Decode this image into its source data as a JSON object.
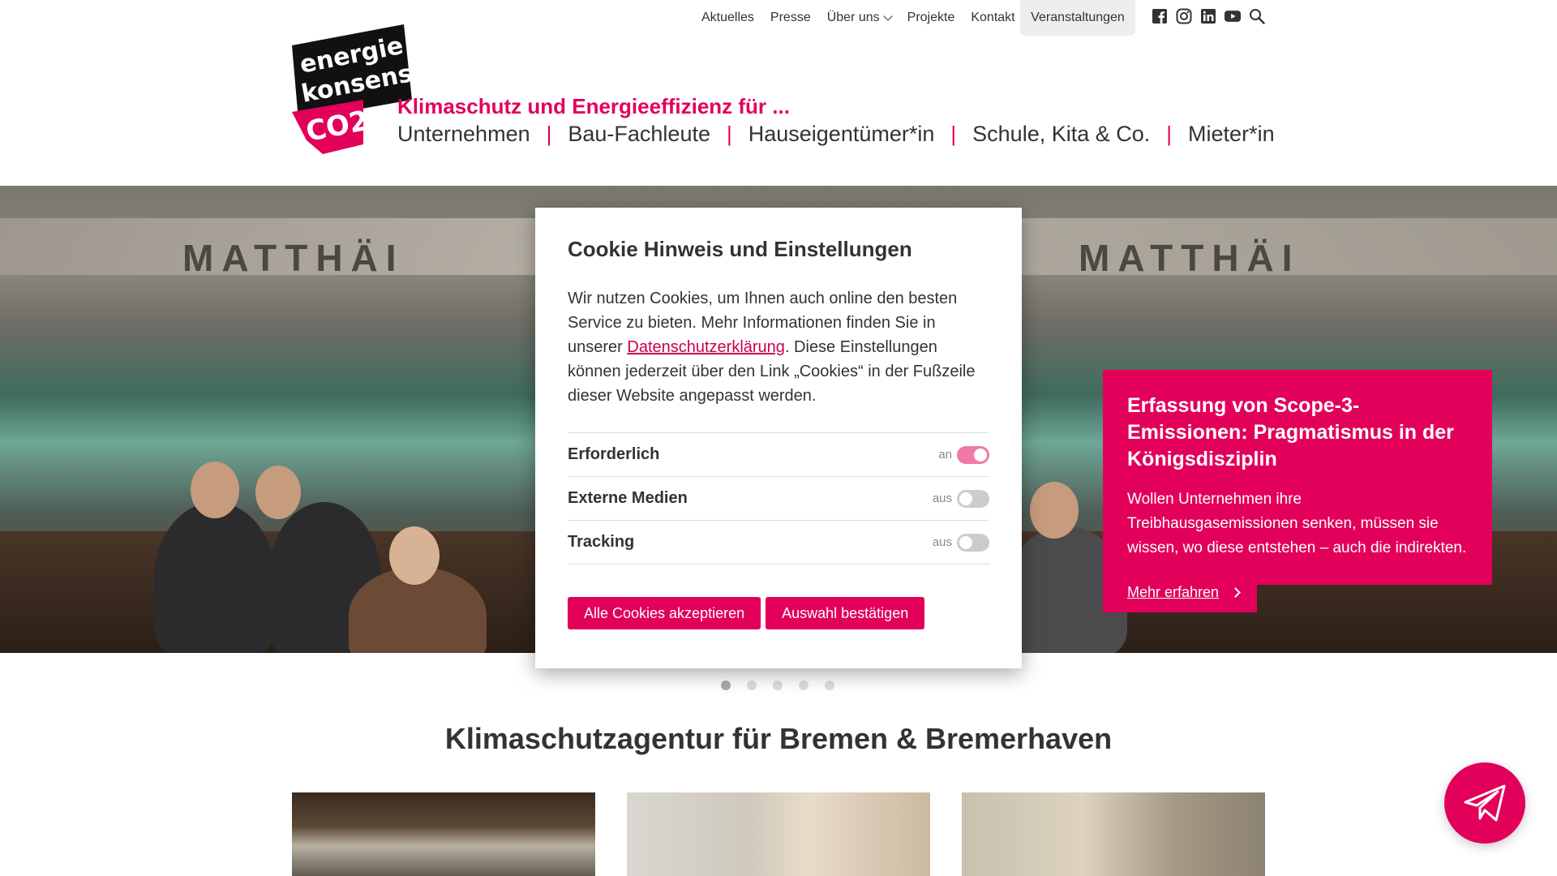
{
  "top_nav": {
    "links": [
      "Aktuelles",
      "Presse",
      "Über uns",
      "Projekte",
      "Kontakt"
    ],
    "events_label": "Veranstaltungen",
    "social_icons": [
      "facebook-icon",
      "instagram-icon",
      "linkedin-icon",
      "youtube-icon"
    ],
    "search_icon": "search-icon"
  },
  "logo": {
    "line1": "energie",
    "line2": "konsens",
    "mark": "CO2"
  },
  "header": {
    "tagline": "Klimaschutz und Energieeffizienz für ...",
    "targets": [
      "Unternehmen",
      "Bau-Fachleute",
      "Hauseigentümer*in",
      "Schule, Kita & Co.",
      "Mieter*in"
    ]
  },
  "hero": {
    "banner_text": "MATTHÄI",
    "promo_title": "Erfassung von Scope-3-Emissionen: Pragmatismus in der Königsdisziplin",
    "promo_text": "Wollen Unternehmen ihre Treibhausgasemissionen senken, müssen sie wissen, wo diese entstehen – auch die indirekten. …",
    "promo_link": "Mehr erfahren",
    "slide_count": 5,
    "active_slide": 1
  },
  "cookie_modal": {
    "title": "Cookie Hinweis und Einstellungen",
    "text_before_link": "Wir nutzen Cookies, um Ihnen auch online den besten Service zu bieten. Mehr Informationen finden Sie in unserer ",
    "link_text": "Datenschutzerklärung",
    "text_after_link": ". Diese Einstellungen können jederzeit über den Link „Cookies“ in der Fußzeile dieser Website angepasst werden.",
    "options": [
      {
        "label": "Erforderlich",
        "state": "an",
        "on": true
      },
      {
        "label": "Externe Medien",
        "state": "aus",
        "on": false
      },
      {
        "label": "Tracking",
        "state": "aus",
        "on": false
      }
    ],
    "accept_all": "Alle Cookies akzeptieren",
    "confirm": "Auswahl bestätigen"
  },
  "section": {
    "title": "Klimaschutzagentur für Bremen & Bremerhaven"
  },
  "colors": {
    "brand": "#e2005a",
    "text": "#333333"
  }
}
